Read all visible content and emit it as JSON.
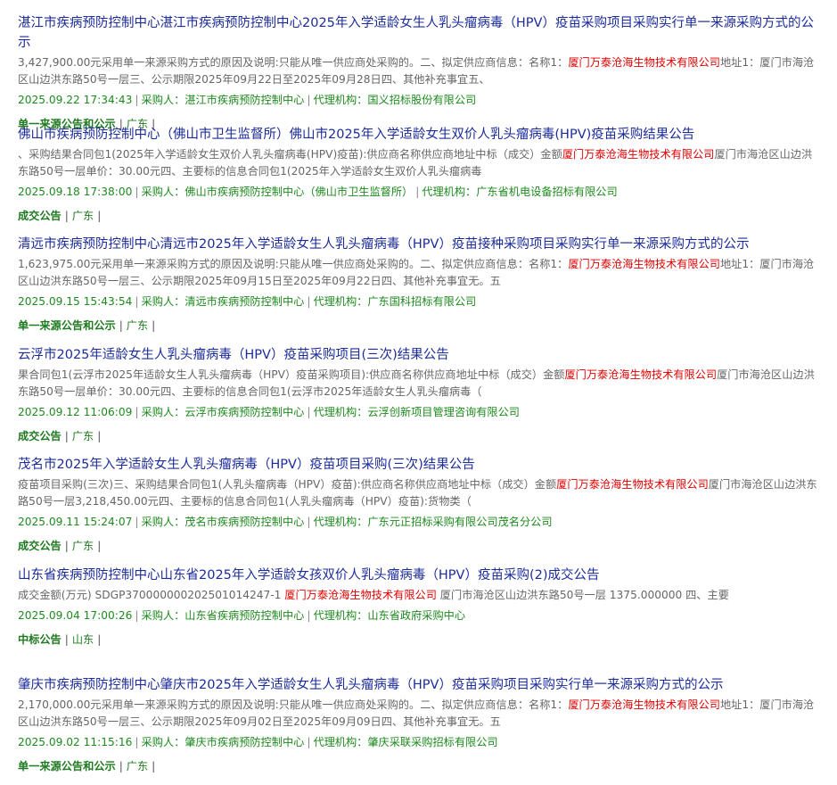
{
  "items": [
    {
      "title": "湛江市疾病预防控制中心湛江市疾病预防控制中心2025年入学适龄女生人乳头瘤病毒（HPV）疫苗采购项目采购实行单一来源采购方式的公示",
      "desc_before": "3,427,900.00元采用单一来源采购方式的原因及说明:只能从唯一供应商处采购的。二、拟定供应商信息：名称1：",
      "supplier": "厦门万泰沧海生物技术有限公司",
      "desc_after": "地址1：厦门市海沧区山边洪东路50号一层三、公示期限2025年09月22日至2025年09月28日四、其他补充事宜五、",
      "datetime": "2025.09.22 17:34:43",
      "buyer": "采购人：湛江市疾病预防控制中心",
      "agent": "代理机构：国义招标股份有限公司",
      "type": "单一来源公告和公示",
      "region": "广东"
    },
    {
      "title": "佛山市疾病预防控制中心（佛山市卫生监督所）佛山市2025年入学适龄女生双价人乳头瘤病毒(HPV)疫苗采购结果公告",
      "desc_before": "、采购结果合同包1(2025年入学适龄女生双价人乳头瘤病毒(HPV)疫苗):供应商名称供应商地址中标（成交）金额",
      "supplier": "厦门万泰沧海生物技术有限公司",
      "desc_after": "厦门市海沧区山边洪东路50号一层单价：30.00元四、主要标的信息合同包1(2025年入学适龄女生双价人乳头瘤病毒",
      "datetime": "2025.09.18 17:38:00",
      "buyer": "采购人：佛山市疾病预防控制中心（佛山市卫生监督所）",
      "agent": "代理机构：广东省机电设备招标有限公司",
      "type": "成交公告",
      "region": "广东"
    },
    {
      "title": "清远市疾病预防控制中心清远市2025年入学适龄女生人乳头瘤病毒（HPV）疫苗接种采购项目采购实行单一来源采购方式的公示",
      "desc_before": "1,623,975.00元采用单一来源采购方式的原因及说明:只能从唯一供应商处采购的。二、拟定供应商信息：名称1：",
      "supplier": "厦门万泰沧海生物技术有限公司",
      "desc_after": "地址1：厦门市海沧区山边洪东路50号一层三、公示期限2025年09月15日至2025年09月22日四、其他补充事宜无。五",
      "datetime": "2025.09.15 15:43:54",
      "buyer": "采购人：清远市疾病预防控制中心",
      "agent": "代理机构：广东国科招标有限公司",
      "type": "单一来源公告和公示",
      "region": "广东"
    },
    {
      "title": "云浮市2025年适龄女生人乳头瘤病毒（HPV）疫苗采购项目(三次)结果公告",
      "desc_before": "果合同包1(云浮市2025年适龄女生人乳头瘤病毒（HPV）疫苗采购项目):供应商名称供应商地址中标（成交）金额",
      "supplier": "厦门万泰沧海生物技术有限公司",
      "desc_after": "厦门市海沧区山边洪东路50号一层单价：30.00元四、主要标的信息合同包1(云浮市2025年适龄女生人乳头瘤病毒（",
      "datetime": "2025.09.12 11:06:09",
      "buyer": "采购人：云浮市疾病预防控制中心",
      "agent": "代理机构：云浮创新项目管理咨询有限公司",
      "type": "成交公告",
      "region": "广东"
    },
    {
      "title": "茂名市2025年入学适龄女生人乳头瘤病毒（HPV）疫苗项目采购(三次)结果公告",
      "desc_before": "疫苗项目采购(三次)三、采购结果合同包1(人乳头瘤病毒（HPV）疫苗):供应商名称供应商地址中标（成交）金额",
      "supplier": "厦门万泰沧海生物技术有限公司",
      "desc_after": "厦门市海沧区山边洪东路50号一层3,218,450.00元四、主要标的信息合同包1(人乳头瘤病毒（HPV）疫苗):货物类（",
      "datetime": "2025.09.11 15:24:07",
      "buyer": "采购人：茂名市疾病预防控制中心",
      "agent": "代理机构：广东元正招标采购有限公司茂名分公司",
      "type": "成交公告",
      "region": "广东"
    },
    {
      "title": "山东省疾病预防控制中心山东省2025年入学适龄女孩双价人乳头瘤病毒（HPV）疫苗采购(2)成交公告",
      "desc_before": "成交金额(万元) SDGP370000000202501014247-1 ",
      "supplier": "厦门万泰沧海生物技术有限公司",
      "desc_after": " 厦门市海沧区山边洪东路50号一层 1375.000000 四、主要",
      "datetime": "2025.09.04 17:00:26",
      "buyer": "采购人：山东省疾病预防控制中心",
      "agent": "代理机构：山东省政府采购中心",
      "type": "中标公告",
      "region": "山东"
    },
    {
      "title": "肇庆市疾病预防控制中心肇庆市2025年入学适龄女生人乳头瘤病毒（HPV）疫苗采购项目采购实行单一来源采购方式的公示",
      "desc_before": "2,170,000.00元采用单一来源采购方式的原因及说明:只能从唯一供应商处采购的。二、拟定供应商信息：名称1：",
      "supplier": "厦门万泰沧海生物技术有限公司",
      "desc_after": "地址1：厦门市海沧区山边洪东路50号一层三、公示期限2025年09月02日至2025年09月09日四、其他补充事宜无。五",
      "datetime": "2025.09.02 11:15:16",
      "buyer": "采购人：肇庆市疾病预防控制中心",
      "agent": "代理机构：肇庆采联采购招标有限公司",
      "type": "单一来源公告和公示",
      "region": "广东"
    }
  ],
  "separator": "|"
}
